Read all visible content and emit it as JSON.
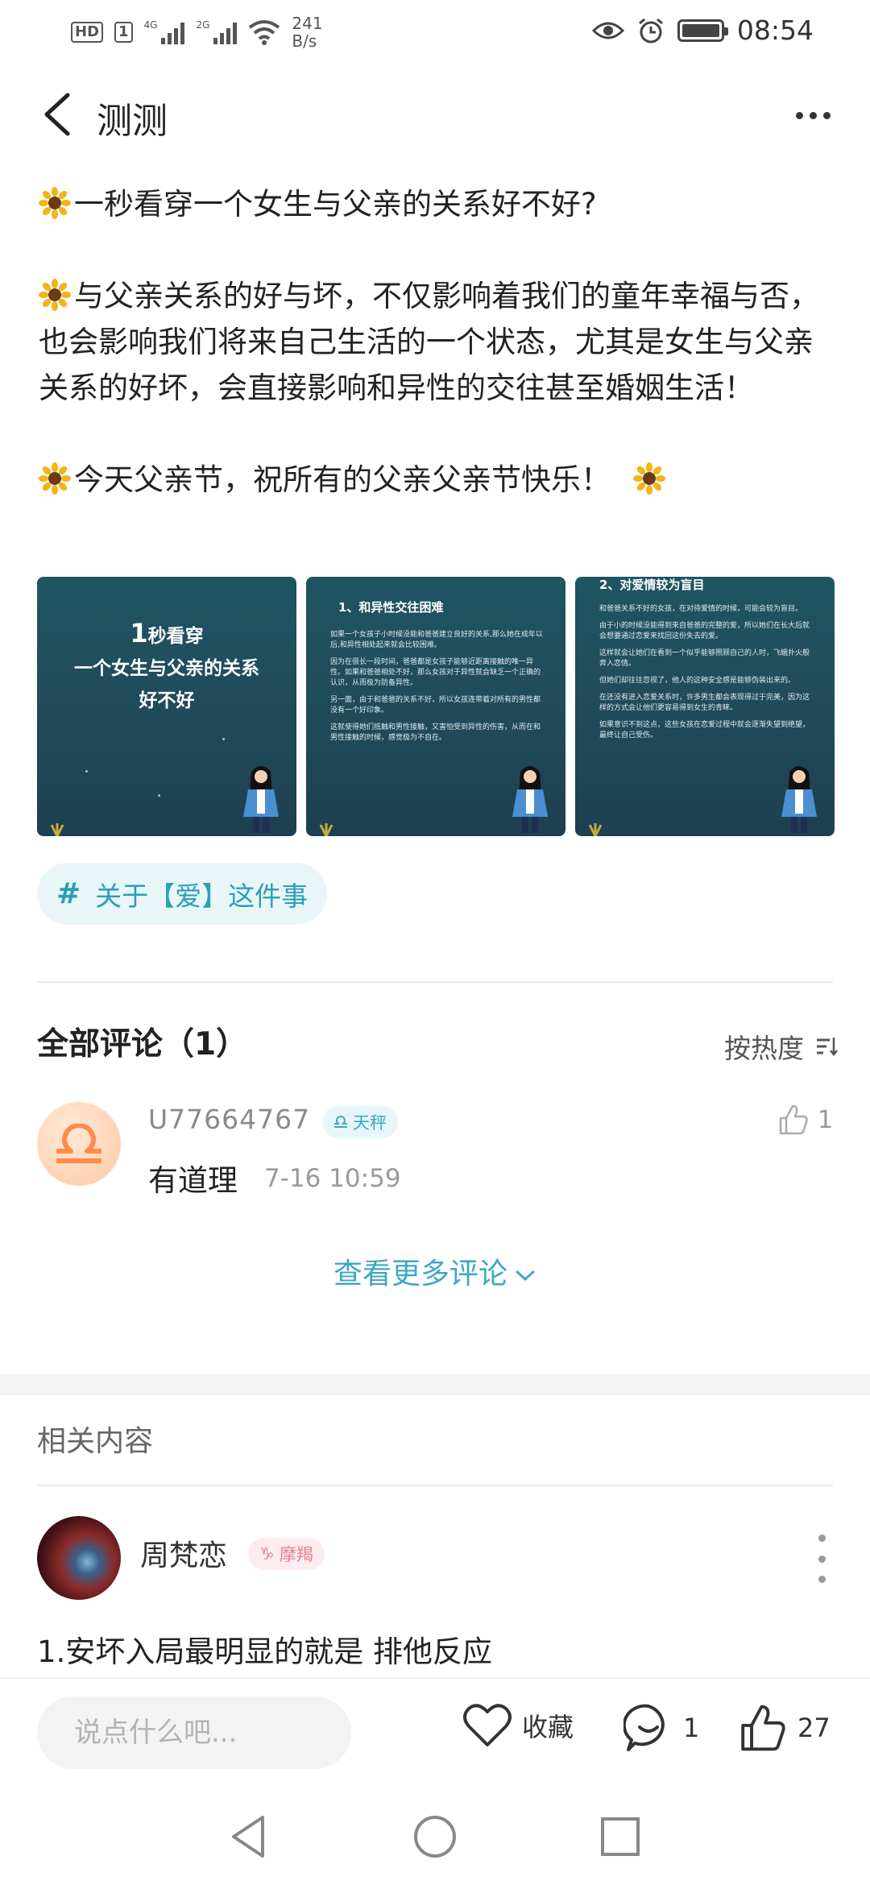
{
  "status_bar": {
    "hd": "HD",
    "sim1": "1",
    "net1": "4G",
    "net2": "2G",
    "speed_value": "241",
    "speed_unit": "B/s",
    "time": "08:54"
  },
  "header": {
    "title": "测测"
  },
  "post": {
    "line1": "一秒看穿一个女生与父亲的关系好不好?",
    "line2": "与父亲关系的好与坏，不仅影响着我们的童年幸福与否，也会影响我们将来自己生活的一个状态，尤其是女生与父亲关系的好坏，会直接影响和异性的交往甚至婚姻生活！",
    "line3": "今天父亲节，祝所有的父亲父亲节快乐！"
  },
  "images": [
    {
      "num": "1",
      "line1": "秒看穿",
      "line2": "一个女生与父亲的关系",
      "line3": "好不好"
    },
    {
      "heading": "1、和异性交往困难",
      "paras": [
        "如果一个女孩子小时候没能和爸爸建立良好的关系,那么她在成年以后,和异性相处起来就会比较困难。",
        "因为在很长一段时间，爸爸都是女孩子能够近距离接触的唯一异性。如果和爸爸相处不好，那么女孩对于异性就会缺乏一个正确的认识，从而极为防备异性。",
        "另一面，由于和爸爸的关系不好，所以女孩连带着对所有的男性都没有一个好印象。",
        "这就使得她们抵触和男性接触，又害怕受到异性的伤害，从而在和男性接触的时候，感觉极为不自在。"
      ]
    },
    {
      "heading": "2、对爱情较为盲目",
      "paras": [
        "和爸爸关系不好的女孩，在对待爱情的时候，可能会较为盲目。",
        "由于小的时候没能得到来自爸爸的完整的爱，所以她们在长大后就会想要通过恋爱来找回这份失去的爱。",
        "这样就会让她们在看到一个似乎能够照顾自己的人时，飞蛾扑火般奔入恋情。",
        "但她们却往往忽视了，他人的这种安全感是能够伪装出来的。",
        "在还没有进入恋爱关系时，许多男生都会表现得过于完美，因为这样的方式会让他们更容易得到女生的青睐。",
        "如果意识不到这点，这些女孩在恋爱过程中就会逐渐失望到绝望，最终让自己受伤。"
      ]
    }
  ],
  "topic": {
    "hash": "#",
    "label": "关于【爱】这件事"
  },
  "comments": {
    "title": "全部评论（1）",
    "sort_label": "按热度",
    "items": [
      {
        "user": "U77664767",
        "zodiac": "天秤",
        "text": "有道理",
        "time": "7-16 10:59",
        "likes": "1"
      }
    ],
    "more_label": "查看更多评论"
  },
  "related": {
    "title": "相关内容",
    "user": "周梵恋",
    "zodiac": "摩羯",
    "text": "1.安坏入局最明显的就是 排他反应"
  },
  "action_bar": {
    "input_placeholder": "说点什么吧...",
    "favorite_label": "收藏",
    "comment_count": "1",
    "like_count": "27"
  },
  "colors": {
    "accent": "#3ea7c4",
    "tag_bg": "#e9f6f8",
    "capricorn": "#ea7f93"
  }
}
